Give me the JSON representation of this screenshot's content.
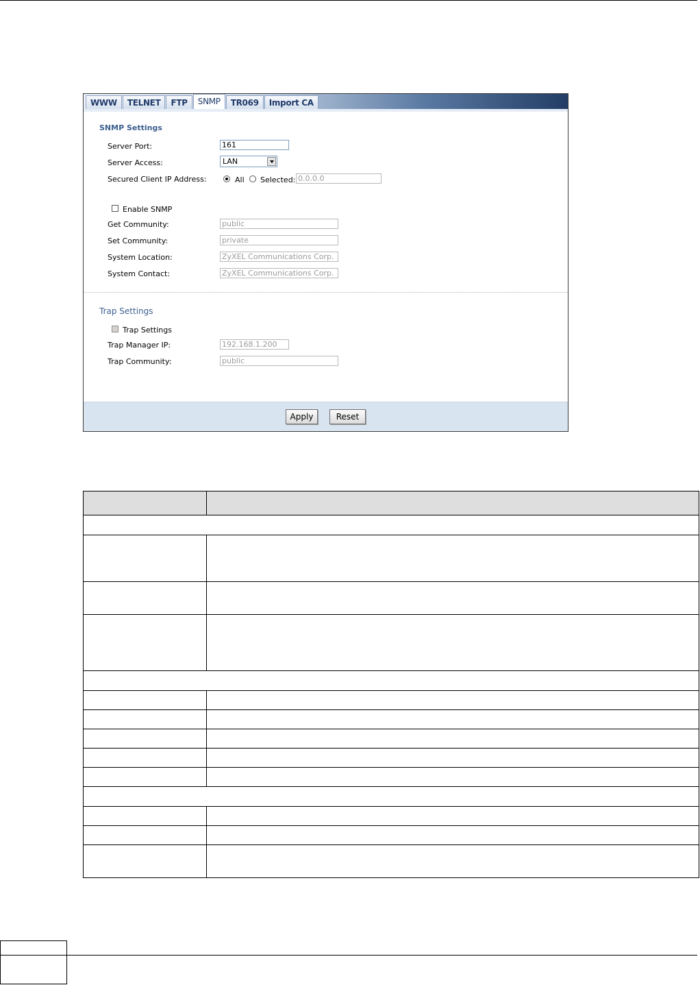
{
  "tabs": [
    "WWW",
    "TELNET",
    "FTP",
    "SNMP",
    "TR069",
    "Import CA"
  ],
  "active_tab": "SNMP",
  "snmp_settings": {
    "title": "SNMP Settings",
    "server_port_label": "Server Port:",
    "server_port_value": "161",
    "server_access_label": "Server Access:",
    "server_access_value": "LAN",
    "secured_client_label": "Secured Client IP Address:",
    "radio_all_label": "All",
    "radio_selected_label": "Selected:",
    "selected_ip_value": "0.0.0.0",
    "enable_snmp_label": "Enable SNMP",
    "get_community_label": "Get Community:",
    "get_community_value": "public",
    "set_community_label": "Set Community:",
    "set_community_value": "private",
    "system_location_label": "System Location:",
    "system_location_value": "ZyXEL Communications Corp.",
    "system_contact_label": "System Contact:",
    "system_contact_value": "ZyXEL Communications Corp."
  },
  "trap_settings": {
    "title": "Trap Settings",
    "trap_checkbox_label": "Trap Settings",
    "trap_manager_label": "Trap Manager IP:",
    "trap_manager_value": "192.168.1.200",
    "trap_community_label": "Trap Community:",
    "trap_community_value": "public"
  },
  "buttons": {
    "apply": "Apply",
    "reset": "Reset"
  }
}
